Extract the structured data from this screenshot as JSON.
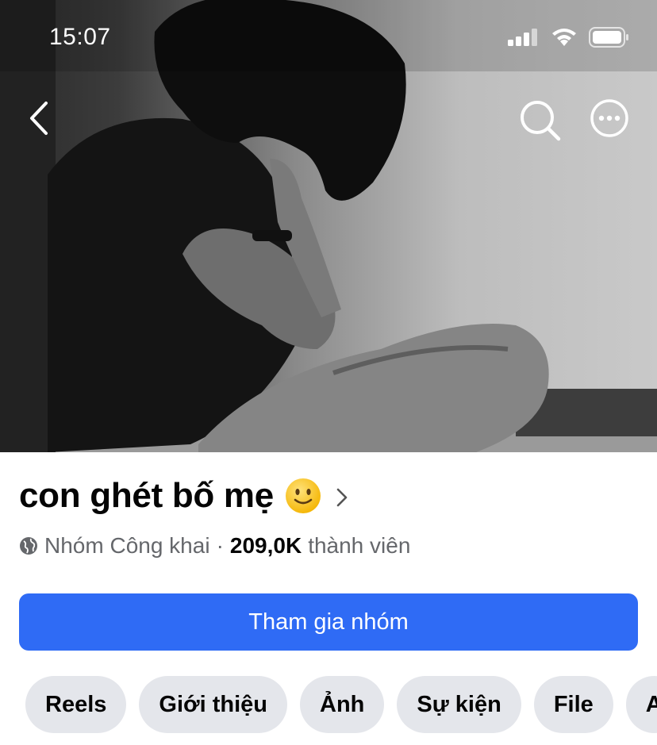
{
  "status_bar": {
    "time": "15:07"
  },
  "cover": {
    "description_icon": "cover-photo"
  },
  "group": {
    "name": "con ghét bố mẹ",
    "privacy": "Nhóm Công khai",
    "separator": "·",
    "member_count": "209,0K",
    "member_label": "thành viên"
  },
  "actions": {
    "join_label": "Tham gia nhóm"
  },
  "tabs": [
    {
      "label": "Reels"
    },
    {
      "label": "Giới thiệu"
    },
    {
      "label": "Ảnh"
    },
    {
      "label": "Sự kiện"
    },
    {
      "label": "File"
    },
    {
      "label": "A"
    }
  ],
  "colors": {
    "primary": "#2f6bf5",
    "chip_bg": "#e4e6eb",
    "secondary_text": "#65676b"
  }
}
